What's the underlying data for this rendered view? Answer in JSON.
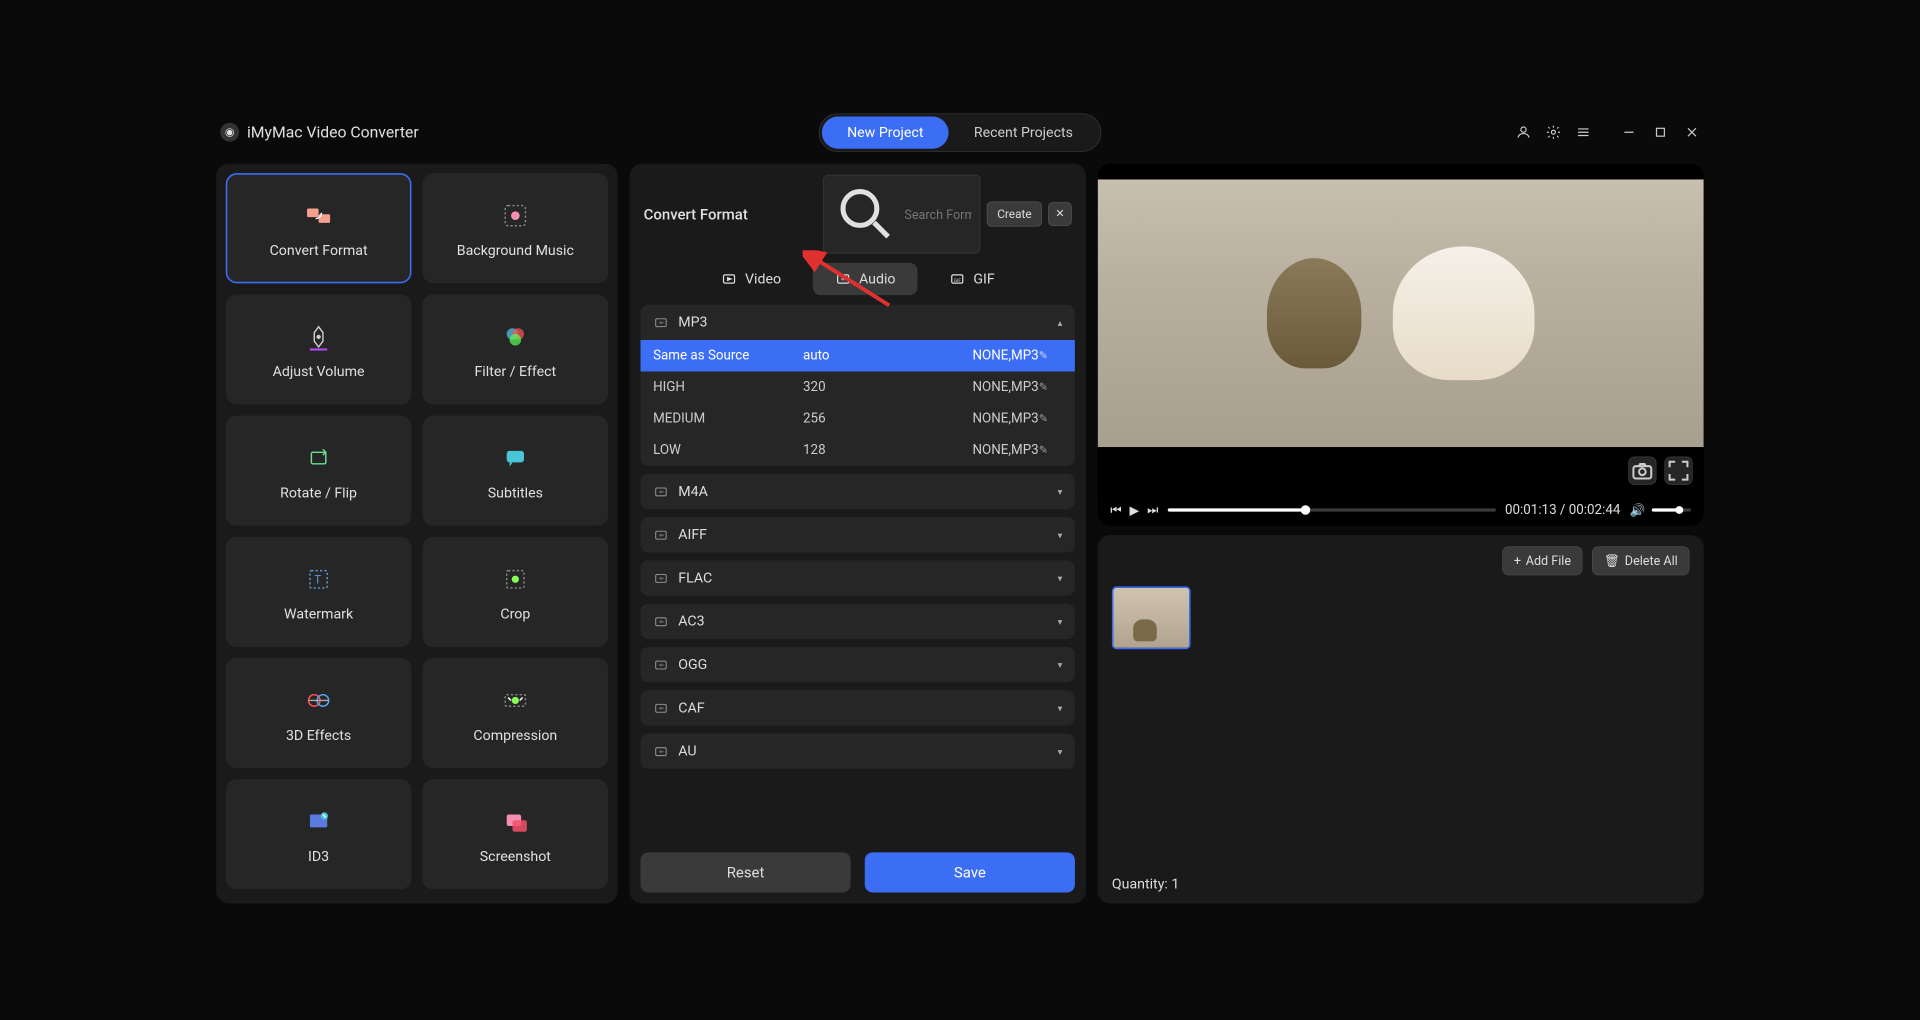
{
  "app": {
    "title": "iMyMac Video Converter"
  },
  "nav": {
    "new_project": "New Project",
    "recent_projects": "Recent Projects"
  },
  "sidebar": {
    "tools": [
      {
        "label": "Convert Format",
        "active": true
      },
      {
        "label": "Background Music",
        "active": false
      },
      {
        "label": "Adjust Volume",
        "active": false
      },
      {
        "label": "Filter / Effect",
        "active": false
      },
      {
        "label": "Rotate / Flip",
        "active": false
      },
      {
        "label": "Subtitles",
        "active": false
      },
      {
        "label": "Watermark",
        "active": false
      },
      {
        "label": "Crop",
        "active": false
      },
      {
        "label": "3D Effects",
        "active": false
      },
      {
        "label": "Compression",
        "active": false
      },
      {
        "label": "ID3",
        "active": false
      },
      {
        "label": "Screenshot",
        "active": false
      }
    ]
  },
  "center": {
    "title": "Convert Format",
    "search_placeholder": "Search Format",
    "create_label": "Create",
    "tabs": {
      "video": "Video",
      "audio": "Audio",
      "gif": "GIF",
      "active": "Audio"
    },
    "formats": [
      {
        "name": "MP3",
        "expanded": true,
        "rows": [
          {
            "quality": "Same as Source",
            "bitrate": "auto",
            "codec": "NONE,MP3",
            "selected": true
          },
          {
            "quality": "HIGH",
            "bitrate": "320",
            "codec": "NONE,MP3",
            "selected": false
          },
          {
            "quality": "MEDIUM",
            "bitrate": "256",
            "codec": "NONE,MP3",
            "selected": false
          },
          {
            "quality": "LOW",
            "bitrate": "128",
            "codec": "NONE,MP3",
            "selected": false
          }
        ]
      },
      {
        "name": "M4A",
        "expanded": false
      },
      {
        "name": "AIFF",
        "expanded": false
      },
      {
        "name": "FLAC",
        "expanded": false
      },
      {
        "name": "AC3",
        "expanded": false
      },
      {
        "name": "OGG",
        "expanded": false
      },
      {
        "name": "CAF",
        "expanded": false
      },
      {
        "name": "AU",
        "expanded": false
      }
    ],
    "reset_label": "Reset",
    "save_label": "Save"
  },
  "preview": {
    "time_current": "00:01:13",
    "time_total": "00:02:44",
    "progress_pct": 42
  },
  "files": {
    "add_label": "Add File",
    "delete_label": "Delete All",
    "quantity_label": "Quantity: 1",
    "count": 1
  }
}
